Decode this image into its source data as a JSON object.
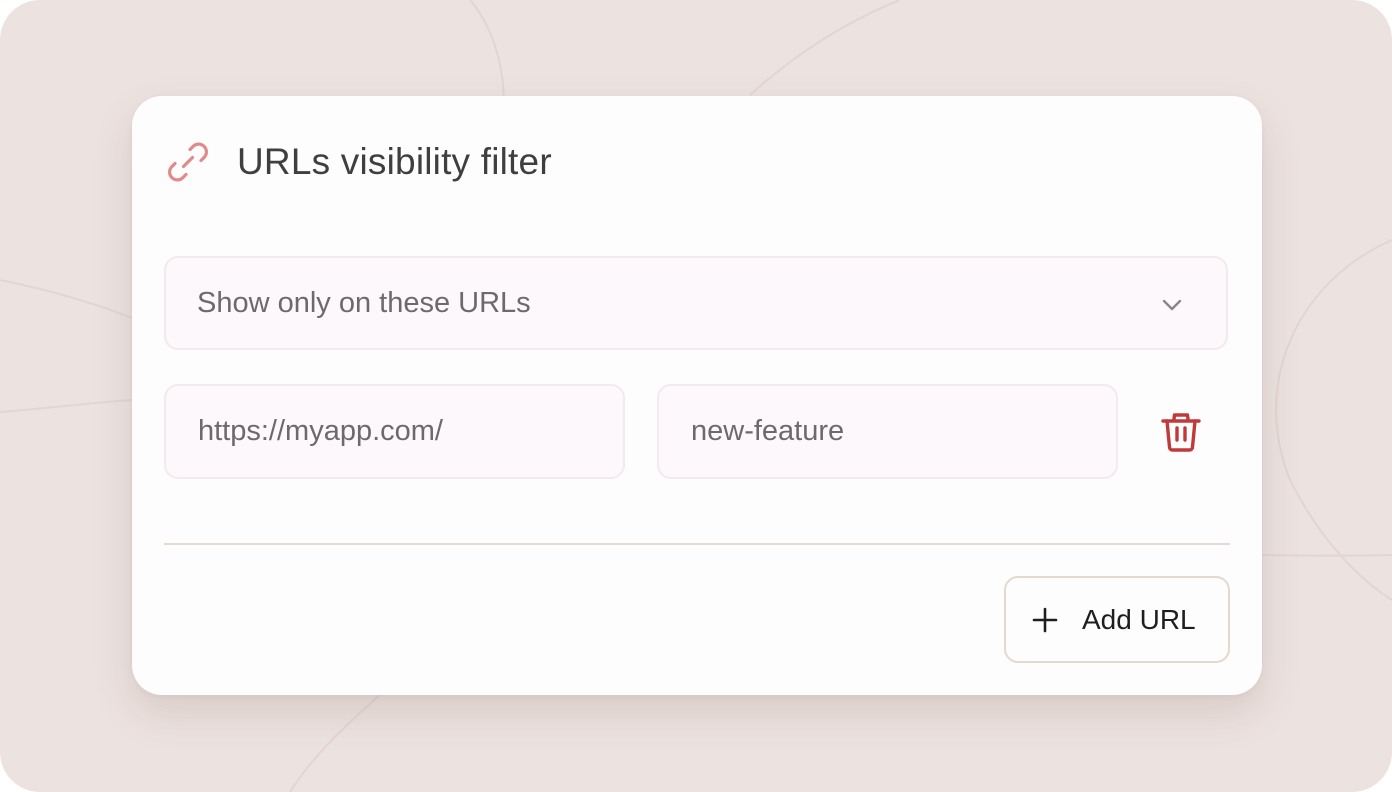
{
  "card": {
    "title": "URLs visibility filter",
    "icon": "link-icon"
  },
  "visibility_select": {
    "value": "Show only on these URLs",
    "icon": "chevron-down-icon"
  },
  "url_rows": [
    {
      "base_url": "https://myapp.com/",
      "path": "new-feature",
      "delete_icon": "trash-icon"
    }
  ],
  "actions": {
    "add_label": "Add URL",
    "add_icon": "plus-icon"
  },
  "colors": {
    "background": "#ece2df",
    "card": "#fefdfd",
    "accent_icon": "#e08a8a",
    "delete_icon": "#c0393b",
    "field_bg": "#fdf8fb",
    "field_border": "#f4e9ee",
    "divider": "#e6d9d4",
    "button_border": "#e3d9cd"
  }
}
